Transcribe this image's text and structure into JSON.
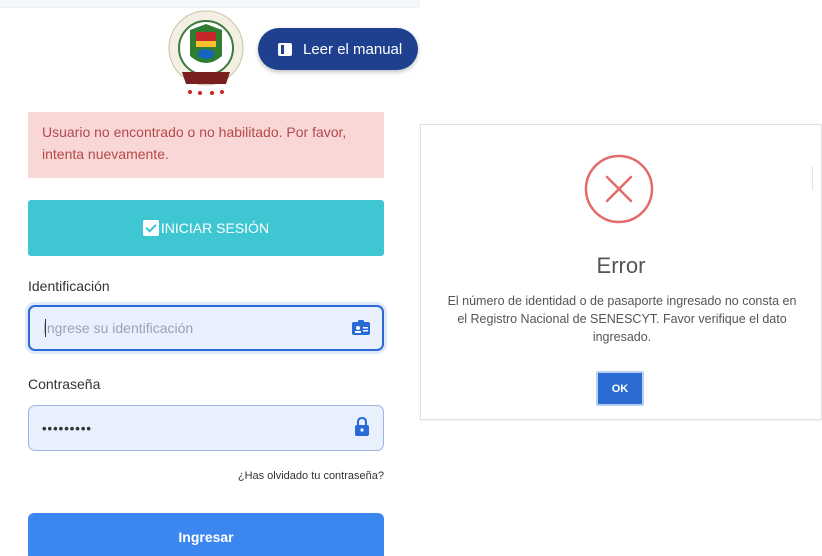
{
  "header": {
    "logo_text": "UNIVERSIDAD ... DE MANABI UNESUM",
    "manual_button": "Leer el manual"
  },
  "alert": {
    "message": "Usuario no encontrado o no habilitado. Por favor, intenta nuevamente."
  },
  "login": {
    "iniciar_label": "INICIAR SESIÓN",
    "id_label": "Identificación",
    "id_placeholder": "Ingrese su identificación",
    "password_label": "Contraseña",
    "password_value": "•••••••••",
    "forgot_link": "¿Has olvidado tu contraseña?",
    "submit_label": "Ingresar"
  },
  "dialog": {
    "title": "Error",
    "message": "El número de identidad o de pasaporte ingresado no consta en el Registro Nacional de SENESCYT. Favor verifique el dato ingresado.",
    "ok_label": "OK"
  },
  "icons": {
    "book": "book-icon",
    "check": "check-square-icon",
    "id_card": "id-card-icon",
    "lock": "lock-icon",
    "error": "error-x-circle-icon"
  },
  "colors": {
    "manual_button": "#1f3f8f",
    "iniciar_button": "#3ec6d3",
    "alert_bg": "#fad7d7",
    "alert_text": "#b4494a",
    "submit_button": "#3c86f0",
    "error_red": "#e46b6b",
    "ok_button": "#2a6cd1"
  }
}
